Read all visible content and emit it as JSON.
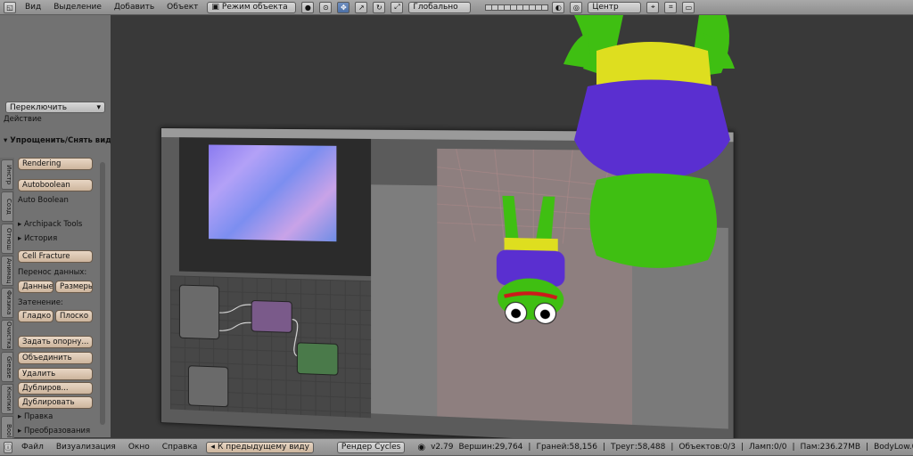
{
  "top_menu": {
    "view": "Вид",
    "select": "Выделение",
    "add": "Добавить",
    "object": "Объект"
  },
  "mode": "Режим объекта",
  "orientation": "Глобально",
  "pivot": "Центр",
  "shelf": {
    "header_action": "Действие",
    "action_select": "Переключить",
    "tabs": [
      "Инстр",
      "Созд",
      "Отнош",
      "Анимац",
      "Физика",
      "Очистка",
      "Grease",
      "Кнопки",
      "Bool",
      "Ref"
    ],
    "section_3dview": "Упрощенить/Снять вид",
    "buttons": {
      "rendering": "Rendering",
      "autoboolean": "Autoboolean",
      "auto_boolean": "Auto Boolean",
      "archipack": "Archipack Tools",
      "history": "История",
      "cell_fracture": "Cell Fracture",
      "data_transfer_label": "Перенос данных:",
      "data": "Данные",
      "layout": "Размеры",
      "shading_label": "Затенение:",
      "smooth": "Гладко",
      "flat": "Плоско",
      "set_origin": "Задать опорну...",
      "join": "Объединить",
      "delete": "Удалить",
      "duplicate": "Дублиров...",
      "duplicate_linked": "Дублировать",
      "edit": "Правка",
      "transform": "Преобразования"
    }
  },
  "status_bar": {
    "file": "Файл",
    "render": "Визуализация",
    "window": "Окно",
    "help": "Справка",
    "back_to_prev": "К предыдущему виду",
    "engine": "Рендер Cycles",
    "version": "v2.79",
    "verts": "Вершин:29,764",
    "faces": "Граней:58,156",
    "tris": "Треуг:58,488",
    "objects": "Объектов:0/3",
    "lamps": "Ламп:0/0",
    "mem": "Пам:236.27MB",
    "active": "BodyLow.001"
  },
  "colors": {
    "frog_green": "#3fbf12",
    "shirt_purple": "#5a2fd0",
    "pants_yellow": "#dede1f",
    "mouth_red": "#cc1a1a",
    "viewport_bg": "#393939",
    "menu_bar": "#9a9a9a",
    "panel_bg": "#727272",
    "node_green": "#3a7a3a"
  },
  "icons": [
    "object-mode-icon",
    "sphere-shading-icon",
    "manipulator-icon",
    "snap-icon",
    "pivot-icon",
    "layer-buttons-icon"
  ]
}
